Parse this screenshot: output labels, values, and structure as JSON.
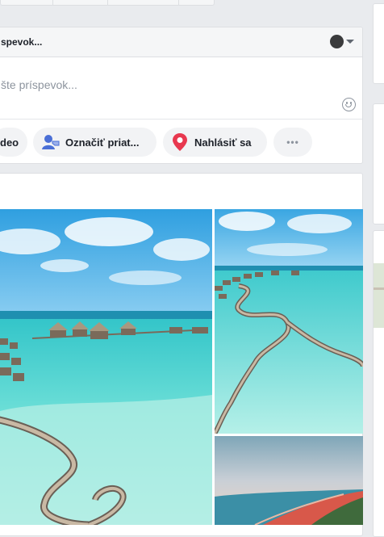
{
  "composer": {
    "title": "spevok...",
    "placeholder": "šte príspevok...",
    "actions": [
      {
        "label": "deo",
        "icon": "video-icon"
      },
      {
        "label": "Označiť priat...",
        "icon": "tag-friends-icon"
      },
      {
        "label": "Nahlásiť sa",
        "icon": "location-pin-icon"
      },
      {
        "label": "•••",
        "icon": "more-icon"
      }
    ],
    "privacy_icon": "privacy-globe-icon"
  },
  "post": {
    "photos": [
      {
        "alt": "maldives-overwater-villas-main"
      },
      {
        "alt": "maldives-winding-boardwalk"
      },
      {
        "alt": "coastline-red-beach-aerial"
      }
    ]
  },
  "colors": {
    "background": "#e9ebee",
    "pin": "#e8384f",
    "tag": "#4a6fd6"
  }
}
